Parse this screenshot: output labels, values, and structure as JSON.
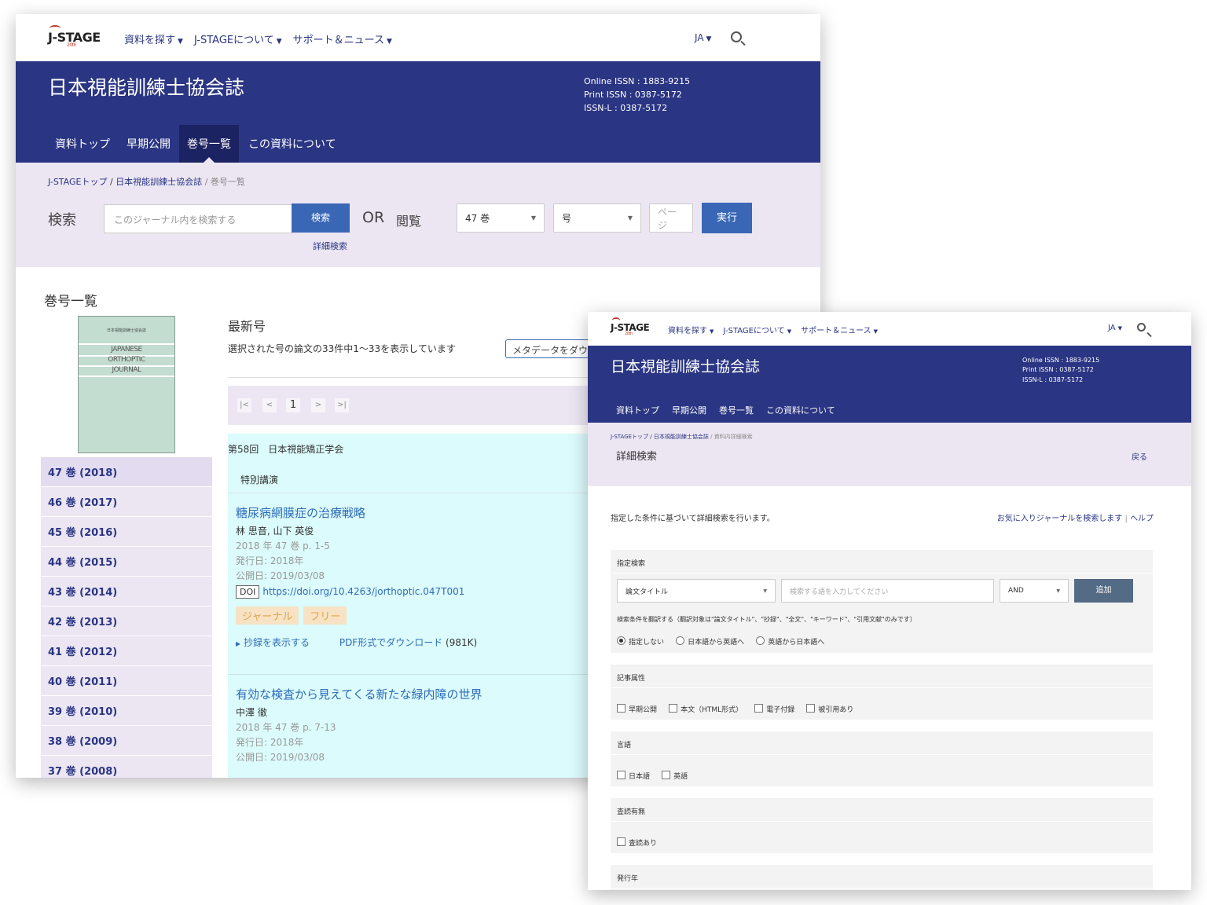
{
  "topnav": {
    "logo": "J-STAGE",
    "logo_sub": "20th",
    "items": [
      "資料を探す",
      "J-STAGEについて",
      "サポート＆ニュース"
    ],
    "lang": "JA"
  },
  "journal": {
    "title": "日本視能訓練士協会誌",
    "online_issn": "Online ISSN : 1883-9215",
    "print_issn": "Print ISSN : 0387-5172",
    "issn_l": "ISSN-L : 0387-5172",
    "tabs": [
      "資料トップ",
      "早期公開",
      "巻号一覧",
      "この資料について"
    ]
  },
  "win1": {
    "breadcrumb": {
      "home": "J-STAGEトップ",
      "journal": "日本視能訓練士協会誌",
      "current": "巻号一覧"
    },
    "search_label": "検索",
    "search_placeholder": "このジャーナル内を検索する",
    "search_button": "検索",
    "or": "OR",
    "browse_label": "閲覧",
    "volume_select": "47 巻",
    "issue_select": "号",
    "page_placeholder": "ページ",
    "go_button": "実行",
    "advanced_link": "詳細検索",
    "section_title": "巻号一覧",
    "cover": {
      "jp": "日本視能訓練士協会誌",
      "en": [
        "JAPANESE",
        "ORTHOPTIC",
        "JOURNAL"
      ]
    },
    "volumes": [
      "47 巻 (2018)",
      "46 巻 (2017)",
      "45 巻 (2016)",
      "44 巻 (2015)",
      "43 巻 (2014)",
      "42 巻 (2013)",
      "41 巻 (2012)",
      "40 巻 (2011)",
      "39 巻 (2010)",
      "38 巻 (2009)",
      "37 巻 (2008)"
    ],
    "latest_title": "最新号",
    "shown_text": "選択された号の論文の33件中1～33を表示しています",
    "metadata_button": "メタデータをダウンロード",
    "pager": [
      "|<",
      "<",
      "1",
      ">",
      ">|"
    ],
    "conference": "第58回　日本視能矯正学会",
    "section_label": "特別講演",
    "articles": [
      {
        "title": "糖尿病網膜症の治療戦略",
        "authors": "林 思音, 山下 英俊",
        "citation": "2018 年 47 巻 p. 1-5",
        "issued": "発行日: 2018年",
        "released": "公開日: 2019/03/08",
        "doi_label": "DOI",
        "doi": "https://doi.org/10.4263/jorthoptic.047T001",
        "badges": [
          "ジャーナル",
          "フリー"
        ],
        "abstract_link": "抄録を表示する",
        "pdf_link": "PDF形式でダウンロード",
        "pdf_size": "(981K)"
      },
      {
        "title": "有効な検査から見えてくる新たな緑内障の世界",
        "authors": "中澤 徹",
        "citation": "2018 年 47 巻 p. 7-13",
        "issued": "発行日: 2018年",
        "released": "公開日: 2019/03/08"
      }
    ]
  },
  "win2": {
    "breadcrumb": {
      "home": "J-STAGEトップ",
      "journal": "日本視能訓練士協会誌",
      "current": "資料内詳細検索"
    },
    "page_title": "詳細検索",
    "back_link": "戻る",
    "lead": "指定した条件に基づいて詳細検索を行います。",
    "fav_link": "お気に入りジャーナルを検索します",
    "help_link": "ヘルプ",
    "spec_search": {
      "heading": "指定検索",
      "field_select": "論文タイトル",
      "term_placeholder": "検索する語を入力してください",
      "op_select": "AND",
      "add_button": "追加",
      "translate_note": "検索条件を翻訳する（翻訳対象は\"論文タイトル\"、\"抄録\"、\"全文\"、\"キーワード\"、\"引用文献\"のみです）",
      "translate_options": [
        "指定しない",
        "日本語から英語へ",
        "英語から日本語へ"
      ]
    },
    "article_attr": {
      "heading": "記事属性",
      "options": [
        "早期公開",
        "本文（HTML形式）",
        "電子付録",
        "被引用あり"
      ]
    },
    "language": {
      "heading": "言語",
      "options": [
        "日本語",
        "英語"
      ]
    },
    "review": {
      "heading": "査読有無",
      "options": [
        "査読あり"
      ]
    },
    "pub_year": {
      "heading": "発行年"
    }
  }
}
